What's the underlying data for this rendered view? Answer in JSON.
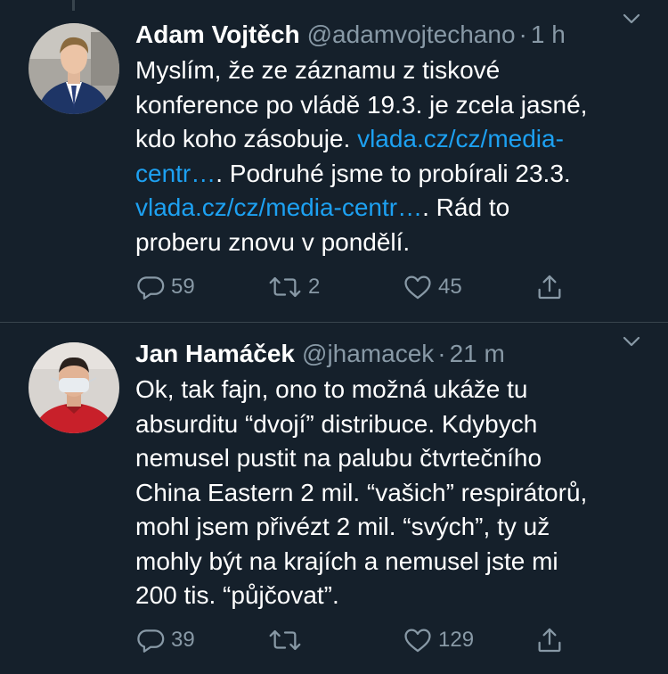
{
  "tweets": [
    {
      "name": "Adam Vojtěch",
      "handle": "@adamvojtechano",
      "separator": "·",
      "time": "1 h",
      "text": {
        "p1": "Myslím, že ze záznamu z tiskové\nkonference po vládě 19.3. je zcela jasné,\nkdo koho zásobuje. ",
        "link1": "vlada.cz/cz/media-\ncentr…",
        "p2": ". Podruhé jsme to probírali 23.3.\n",
        "link2": "vlada.cz/cz/media-centr…",
        "p3": ". Rád to\nproberu znovu v pondělí."
      },
      "replies": "59",
      "retweets": "2",
      "likes": "45"
    },
    {
      "name": "Jan Hamáček",
      "handle": "@jhamacek",
      "separator": "·",
      "time": "21 m",
      "text": "Ok, tak fajn, ono to možná ukáže tu\nabsurditu “dvojí” distribuce. Kdybych\nnemusel pustit na palubu čtvrtečního\nChina Eastern 2 mil. “vašich” respirátorů,\nmohl jsem přivézt 2 mil. “svých”, ty už\nmohly být na krajích a nemusel jste mi\n200 tis. “půjčovat”.",
      "replies": "39",
      "retweets": "",
      "likes": "129"
    }
  ],
  "colors": {
    "background": "#15202b",
    "text": "#ffffff",
    "secondary": "#8899a6",
    "link": "#1da1f2",
    "divider": "#38444d"
  },
  "icons": {
    "reply": "reply-icon",
    "retweet": "retweet-icon",
    "like": "heart-icon",
    "share": "share-icon",
    "caret": "chevron-down-icon"
  }
}
